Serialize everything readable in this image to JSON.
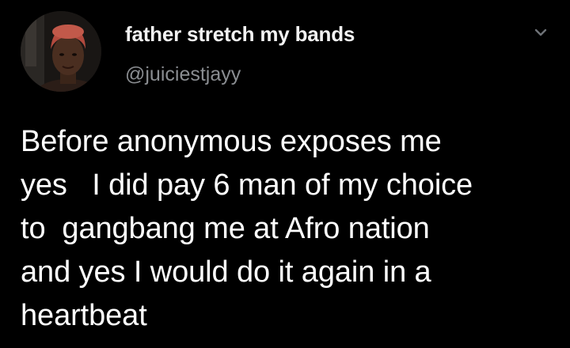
{
  "tweet": {
    "display_name": "father stretch my bands",
    "handle": "@juiciestjayy",
    "text": "Before anonymous exposes me\nyes   I did pay 6 man of my choice\nto  gangbang me at Afro nation\nand yes I would do it again in a\nheartbeat"
  },
  "icons": {
    "avatar": "profile-photo",
    "menu": "chevron-down-icon"
  },
  "colors": {
    "background": "#000000",
    "name_text": "#f2f2f2",
    "handle_text": "#8a8d91",
    "body_text": "#ffffff",
    "chevron": "#6e7277"
  }
}
